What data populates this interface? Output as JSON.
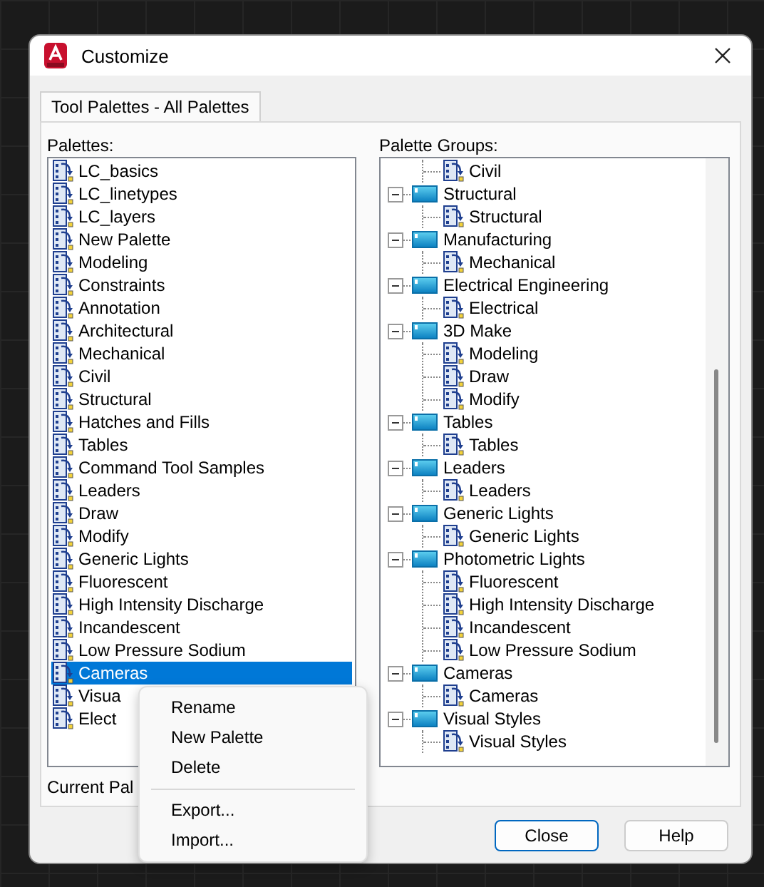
{
  "window": {
    "title": "Customize"
  },
  "tabs": [
    {
      "label": "Tool Palettes - All Palettes",
      "selected": true
    }
  ],
  "palettes": {
    "label": "Palettes:",
    "items": [
      {
        "label": "LC_basics",
        "selected": false
      },
      {
        "label": "LC_linetypes",
        "selected": false
      },
      {
        "label": "LC_layers",
        "selected": false
      },
      {
        "label": "New Palette",
        "selected": false
      },
      {
        "label": "Modeling",
        "selected": false
      },
      {
        "label": "Constraints",
        "selected": false
      },
      {
        "label": "Annotation",
        "selected": false
      },
      {
        "label": "Architectural",
        "selected": false
      },
      {
        "label": "Mechanical",
        "selected": false
      },
      {
        "label": "Civil",
        "selected": false
      },
      {
        "label": "Structural",
        "selected": false
      },
      {
        "label": "Hatches and Fills",
        "selected": false
      },
      {
        "label": "Tables",
        "selected": false
      },
      {
        "label": "Command Tool Samples",
        "selected": false
      },
      {
        "label": "Leaders",
        "selected": false
      },
      {
        "label": "Draw",
        "selected": false
      },
      {
        "label": "Modify",
        "selected": false
      },
      {
        "label": "Generic Lights",
        "selected": false
      },
      {
        "label": "Fluorescent",
        "selected": false
      },
      {
        "label": "High Intensity Discharge",
        "selected": false
      },
      {
        "label": "Incandescent",
        "selected": false
      },
      {
        "label": "Low Pressure Sodium",
        "selected": false
      },
      {
        "label": "Cameras",
        "selected": true
      },
      {
        "label": "Visua",
        "selected": false
      },
      {
        "label": "Elect",
        "selected": false
      }
    ]
  },
  "current_palette_label": "Current Pal",
  "palette_groups": {
    "label": "Palette Groups:",
    "items": [
      {
        "kind": "palette",
        "label": "Civil"
      },
      {
        "kind": "group",
        "label": "Structural",
        "expanded": true,
        "children": [
          {
            "kind": "palette",
            "label": "Structural"
          }
        ]
      },
      {
        "kind": "group",
        "label": "Manufacturing",
        "expanded": true,
        "children": [
          {
            "kind": "palette",
            "label": "Mechanical"
          }
        ]
      },
      {
        "kind": "group",
        "label": "Electrical Engineering",
        "expanded": true,
        "children": [
          {
            "kind": "palette",
            "label": "Electrical"
          }
        ]
      },
      {
        "kind": "group",
        "label": "3D Make",
        "expanded": true,
        "children": [
          {
            "kind": "palette",
            "label": "Modeling"
          },
          {
            "kind": "palette",
            "label": "Draw"
          },
          {
            "kind": "palette",
            "label": "Modify"
          }
        ]
      },
      {
        "kind": "group",
        "label": "Tables",
        "expanded": true,
        "children": [
          {
            "kind": "palette",
            "label": "Tables"
          }
        ]
      },
      {
        "kind": "group",
        "label": "Leaders",
        "expanded": true,
        "children": [
          {
            "kind": "palette",
            "label": "Leaders"
          }
        ]
      },
      {
        "kind": "group",
        "label": "Generic Lights",
        "expanded": true,
        "children": [
          {
            "kind": "palette",
            "label": "Generic Lights"
          }
        ]
      },
      {
        "kind": "group",
        "label": "Photometric Lights",
        "expanded": true,
        "children": [
          {
            "kind": "palette",
            "label": "Fluorescent"
          },
          {
            "kind": "palette",
            "label": "High Intensity Discharge"
          },
          {
            "kind": "palette",
            "label": "Incandescent"
          },
          {
            "kind": "palette",
            "label": "Low Pressure Sodium"
          }
        ]
      },
      {
        "kind": "group",
        "label": "Cameras",
        "expanded": true,
        "children": [
          {
            "kind": "palette",
            "label": "Cameras"
          }
        ]
      },
      {
        "kind": "group",
        "label": "Visual Styles",
        "expanded": true,
        "children": [
          {
            "kind": "palette",
            "label": "Visual Styles"
          }
        ]
      }
    ]
  },
  "context_menu": {
    "sections": [
      {
        "items": [
          "Rename",
          "New Palette",
          "Delete"
        ]
      },
      {
        "items": [
          "Export...",
          "Import..."
        ]
      }
    ]
  },
  "buttons": [
    {
      "label": "Close",
      "default": true
    },
    {
      "label": "Help",
      "default": false
    }
  ]
}
